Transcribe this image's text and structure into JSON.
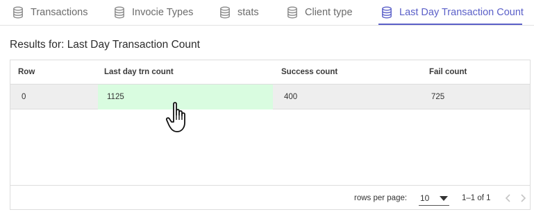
{
  "tabs": [
    {
      "label": "Transactions",
      "icon": "database-icon",
      "active": false
    },
    {
      "label": "Invocie Types",
      "icon": "database-icon",
      "active": false
    },
    {
      "label": "stats",
      "icon": "database-icon",
      "active": false
    },
    {
      "label": "Client type",
      "icon": "database-icon",
      "active": false
    },
    {
      "label": "Last Day Transaction Count",
      "icon": "database-icon",
      "active": true
    }
  ],
  "results": {
    "title": "Results for: Last Day Transaction Count"
  },
  "table": {
    "columns": [
      "Row",
      "Last day trn count",
      "Success count",
      "Fail count"
    ],
    "rows": [
      [
        "0",
        "1125",
        "400",
        "725"
      ]
    ]
  },
  "pagination": {
    "rows_per_page_label": "rows per page:",
    "rows_per_page_value": "10",
    "range_text": "1–1 of 1"
  },
  "colors": {
    "accent": "#5a5fc8",
    "highlight_cell": "#d9fce0",
    "row_selected": "#eeeeee"
  }
}
